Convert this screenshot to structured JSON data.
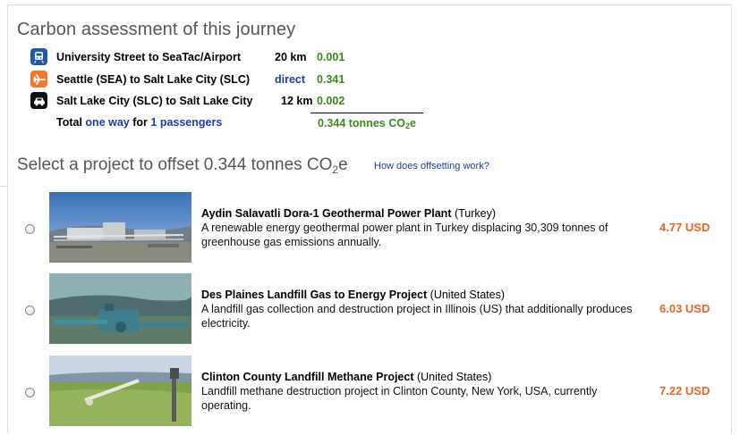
{
  "header": {
    "title": "Carbon assessment of this journey"
  },
  "legs": [
    {
      "icon": "train-icon",
      "route": "University Street to SeaTac/Airport",
      "distance": "20 km",
      "co2": "0.001"
    },
    {
      "icon": "plane-icon",
      "route": "Seattle (SEA) to Salt Lake City (SLC)",
      "distance": "direct",
      "co2": "0.341"
    },
    {
      "icon": "car-icon",
      "route": "Salt Lake City (SLC) to Salt Lake City",
      "distance": "12 km",
      "co2": "0.002"
    }
  ],
  "total": {
    "prefix": "Total",
    "trip_type": "one way",
    "for_text": "for",
    "passengers": "1 passengers",
    "value": "0.344 tonnes CO",
    "sub": "2",
    "suffix": "e"
  },
  "select": {
    "heading_prefix": "Select a project to offset 0.344 tonnes CO",
    "heading_sub": "2",
    "heading_suffix": "e",
    "help_link": "How does offsetting work?"
  },
  "projects": [
    {
      "name": "Aydin Salavatli Dora-1 Geothermal Power Plant",
      "country": "(Turkey)",
      "description": "A renewable energy geothermal power plant in Turkey displacing 30,309 tonnes of greenhouse gas emissions annually.",
      "price": "4.77 USD"
    },
    {
      "name": "Des Plaines Landfill Gas to Energy Project",
      "country": "(United States)",
      "description": "A landfill gas collection and destruction project in Illinois (US) that additionally produces electricity.",
      "price": "6.03 USD"
    },
    {
      "name": "Clinton County Landfill Methane Project",
      "country": "(United States)",
      "description": "Landfill methane destruction project in Clinton County, New York, USA, currently operating.",
      "price": "7.22 USD"
    }
  ],
  "colors": {
    "co2_green": "#3b8a1e",
    "link_blue": "#1f3d9e",
    "price_orange": "#e8662a",
    "train_icon_bg": "#1e5aa8",
    "plane_icon_bg": "#f07a2a",
    "car_icon_bg": "#111111"
  }
}
